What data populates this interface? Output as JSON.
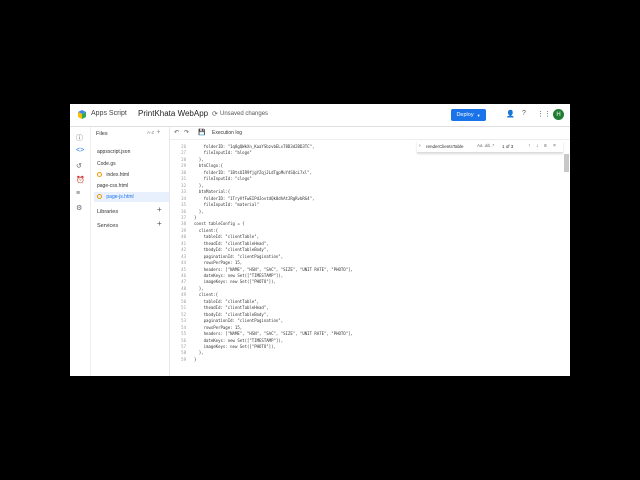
{
  "header": {
    "brand": "Apps Script",
    "project_name": "PrintKhata WebApp",
    "unsaved_status": "Unsaved changes",
    "deploy_label": "Deploy",
    "avatar_letter": "H"
  },
  "files_panel": {
    "title": "Files",
    "sort_label": "A-Z",
    "items": [
      {
        "label": "appsscript.json"
      },
      {
        "label": "Code.gs"
      },
      {
        "label": "index.html"
      },
      {
        "label": "page-css.html"
      },
      {
        "label": "page-js.html"
      }
    ],
    "libraries_label": "Libraries",
    "services_label": "Services"
  },
  "toolbar": {
    "execution_log_label": "Execution log"
  },
  "find_widget": {
    "query": "renderClientsTable",
    "options": "Aa .ab .*",
    "count": "1 of 3"
  },
  "colors": {
    "accent": "#1a73e8",
    "avatar": "#1e7d32"
  },
  "editor": {
    "lines": [
      {
        "n": "26",
        "t": "    folderID: \"1q8gQWkXn_KaaYSbzvbELvT8D3d2BD3TC\","
      },
      {
        "n": "27",
        "t": "    fileInputId: \"blogo\""
      },
      {
        "n": "28",
        "t": "  },"
      },
      {
        "n": "29",
        "t": "  btnClogo:{"
      },
      {
        "n": "30",
        "t": "    folderID: \"1BtsUIR9fjgYZqjJLdTgpMuY4SQcL7xl\","
      },
      {
        "n": "31",
        "t": "    fileInputId: \"clogo\""
      },
      {
        "n": "32",
        "t": "  },"
      },
      {
        "n": "33",
        "t": "  btnMaterial:{"
      },
      {
        "n": "34",
        "t": "    folderID: \"1TryVfFwEIPdJovtdQk8dhAtJRgRvbRG4\","
      },
      {
        "n": "35",
        "t": "    fileInputId: \"material\""
      },
      {
        "n": "36",
        "t": "  },"
      },
      {
        "n": "37",
        "t": "}"
      },
      {
        "n": "38",
        "t": "const tableConfig = {"
      },
      {
        "n": "39",
        "t": "  client:{"
      },
      {
        "n": "40",
        "t": "    tableId: \"clientTable\","
      },
      {
        "n": "41",
        "t": "    theadId: \"clientTableHead\","
      },
      {
        "n": "42",
        "t": "    tbodyId: \"clientTableBody\","
      },
      {
        "n": "43",
        "t": "    paginationId: \"clientPagination\","
      },
      {
        "n": "44",
        "t": "    rowsPerPage: 15,"
      },
      {
        "n": "45",
        "t": "    headers: [\"NAME\", \"HSN\", \"SAC\", \"SIZE\", \"UNIT RATE\", \"PHOTO\"],"
      },
      {
        "n": "46",
        "t": "    dateKeys: new Set([\"TIMESTAMP\"]),"
      },
      {
        "n": "47",
        "t": "    imageKeys: new Set([\"PHOTO\"]),"
      },
      {
        "n": "48",
        "t": "  },"
      },
      {
        "n": "49",
        "t": "  client:{"
      },
      {
        "n": "50",
        "t": "    tableId: \"clientTable\","
      },
      {
        "n": "51",
        "t": "    theadId: \"clientTableHead\","
      },
      {
        "n": "52",
        "t": "    tbodyId: \"clientTableBody\","
      },
      {
        "n": "53",
        "t": "    paginationId: \"clientPagination\","
      },
      {
        "n": "54",
        "t": "    rowsPerPage: 15,"
      },
      {
        "n": "55",
        "t": "    headers: [\"NAME\", \"HSN\", \"SAC\", \"SIZE\", \"UNIT RATE\", \"PHOTO\"],"
      },
      {
        "n": "56",
        "t": "    dateKeys: new Set([\"TIMESTAMP\"]),"
      },
      {
        "n": "57",
        "t": "    imageKeys: new Set([\"PHOTO\"]),"
      },
      {
        "n": "58",
        "t": "  },"
      },
      {
        "n": "59",
        "t": "}"
      }
    ]
  }
}
